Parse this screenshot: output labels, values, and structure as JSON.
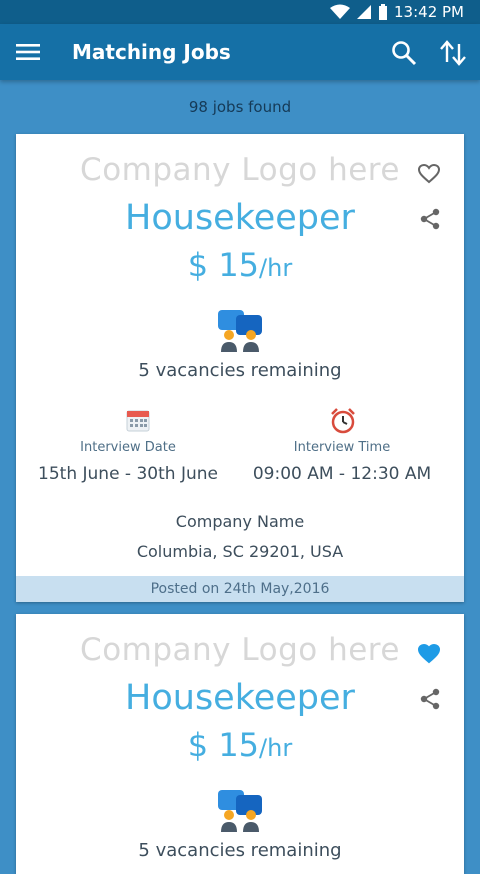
{
  "status": {
    "time": "13:42 PM"
  },
  "appbar": {
    "title": "Matching Jobs"
  },
  "results": {
    "count_text": "98 jobs found"
  },
  "cards": [
    {
      "logo_placeholder": "Company Logo here",
      "job_title": "Housekeeper",
      "wage_amount": "$ 15",
      "wage_unit": "/hr",
      "vacancies": "5 vacancies remaining",
      "interview_date_label": "Interview Date",
      "interview_date": "15th June - 30th June",
      "interview_time_label": "Interview Time",
      "interview_time": "09:00 AM - 12:30 AM",
      "company_name": "Company Name",
      "address": "Columbia, SC 29201, USA",
      "posted": "Posted on 24th May,2016",
      "favorited": false
    },
    {
      "logo_placeholder": "Company Logo here",
      "job_title": "Housekeeper",
      "wage_amount": "$ 15",
      "wage_unit": "/hr",
      "vacancies": "5 vacancies remaining",
      "favorited": true
    }
  ],
  "colors": {
    "accent": "#45aee0",
    "appbar": "#1570a6",
    "statusbar": "#0f5e8b",
    "background": "#3e8fc6",
    "favorite_active": "#1e9be6"
  },
  "icons": {
    "menu": "menu-icon",
    "search": "search-icon",
    "sort": "sort-icon",
    "favorite": "heart-icon",
    "share": "share-icon",
    "vacancies": "people-icon",
    "date": "calendar-icon",
    "time": "alarm-clock-icon"
  }
}
